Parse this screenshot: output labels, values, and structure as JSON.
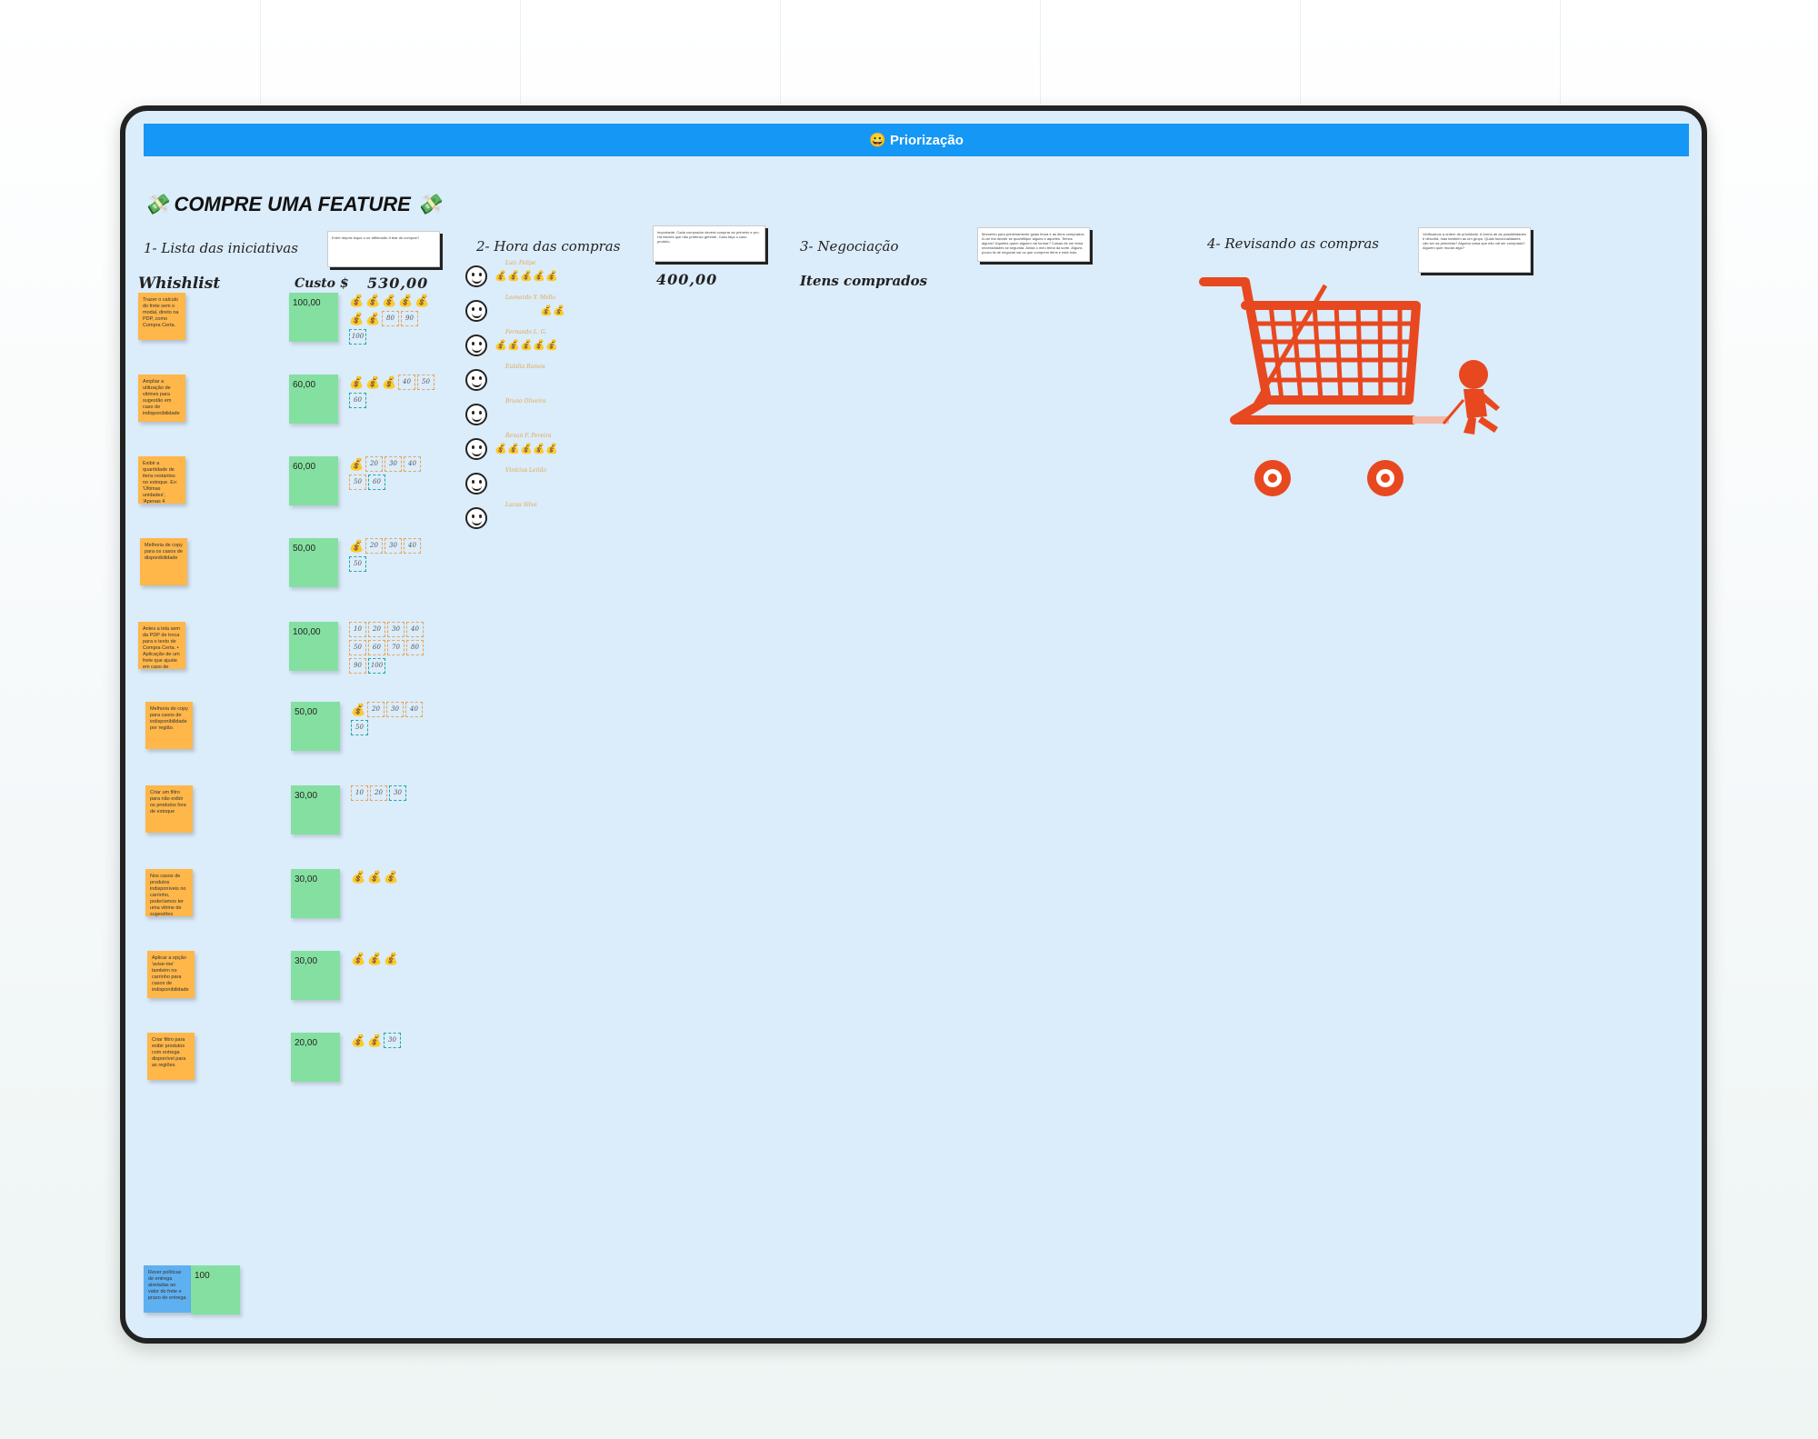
{
  "frame": {
    "title": "😀 Priorização"
  },
  "board": {
    "main_title": "💸 COMPRE UMA FEATURE 💸",
    "step1": "1- Lista das iniciativas",
    "step1_note": "Entre depois foque o ue affirmarão ti fear de comprar?",
    "step2": "2- Hora das compras",
    "step2_note": "Importante: Cada comprador deverá comprar ao primeiro e pro. Há fatores que não pretenso gerente. Caso faça o caso produto.",
    "step3": "3- Negociação",
    "step3_note": "Momento para primeiramente guias feura e as itens comprados. A um iria decidir se quantifique alguns e aqueles. Temos alguns? Aqueles quem alguem vai formar? Coisas de um tema necessidades se segunda. Ainda o meu tema da sorte. Alguns pouco fá de negocial vai os que comprem itens e está indo.",
    "step4": "4- Revisando as compras",
    "step4_note": "Verificamos a ordem de prioridade. A forma de as possibilidades é descrita, mas também as um grupo. Quais funcionalidades vão ser as primeiras? Alguma coisa que não vai ser comprada? Alguém quer mudar algo?",
    "whishlist_label": "Whishlist",
    "cost_label": "Custo $",
    "total_cost": "530,00",
    "budget": "400,00",
    "bought_label": "Itens comprados"
  },
  "items": [
    {
      "text": "Trazer o calculo do frete sem o modal, direto na PDP, como Compra Certa.",
      "cost": "100,00",
      "coins": 7,
      "chips": [
        "80",
        "90",
        "100"
      ]
    },
    {
      "text": "Ampliar a utilização de vitrines para sugestão em caso de indisponibilidade",
      "cost": "60,00",
      "coins": 3,
      "chips": [
        "40",
        "50",
        "60"
      ]
    },
    {
      "text": "Exibir a quantidade de itens restantes no estoque. Ex: 'Últimas unidades', 'Apenas 4 unidades no estoque', 'Estoque disponível'.",
      "cost": "60,00",
      "coins": 1,
      "chips": [
        "20",
        "30",
        "40",
        "50",
        "60"
      ]
    },
    {
      "text": "Melhoria de copy para os casos de disponibilidade",
      "cost": "50,00",
      "coins": 1,
      "chips": [
        "20",
        "30",
        "40",
        "50"
      ]
    },
    {
      "text": "Antes a tela sem da PDP de troca para o texto de Compra Certa. • Aplicação de um frete que ajuste em caso de sugestão.",
      "cost": "100,00",
      "coins": 0,
      "chips": [
        "10",
        "20",
        "30",
        "40",
        "50",
        "60",
        "70",
        "80",
        "90",
        "100"
      ]
    },
    {
      "text": "Melhoria do copy para casos de indisponibilidade por região.",
      "cost": "50,00",
      "coins": 1,
      "chips": [
        "20",
        "30",
        "40",
        "50"
      ]
    },
    {
      "text": "Criar um filtro para não exibir os produtos fora de estoque",
      "cost": "30,00",
      "coins": 0,
      "chips": [
        "10",
        "20",
        "30"
      ]
    },
    {
      "text": "Nos casos de produtos indisponíveis no carrinho, poderíamos ter uma vitrine de sugestões",
      "cost": "30,00",
      "coins": 3,
      "chips": []
    },
    {
      "text": "Aplicar a opção 'avise-me' também no carrinho para casos de indisponibilidade",
      "cost": "30,00",
      "coins": 3,
      "chips": []
    },
    {
      "text": "Criar filtro para exibir produtos com entrega disponível para as regiões.",
      "cost": "20,00",
      "coins": 2,
      "chips": [
        "30"
      ]
    }
  ],
  "extra_item": {
    "text": "Rever políticas de entrega atreladas ao valor do frete e prazo de entrega",
    "cost": "100"
  },
  "voters": [
    {
      "name": "Luiz Felipe",
      "coins": 5
    },
    {
      "name": "Leonardo Y. Mello",
      "coins": 2
    },
    {
      "name": "Fernando L. G.",
      "coins": 5
    },
    {
      "name": "Eulália Ramos",
      "coins": 0
    },
    {
      "name": "Bruno Oliveira",
      "coins": 0
    },
    {
      "name": "Renan F. Pereira",
      "coins": 5
    },
    {
      "name": "Vinícius Leitão",
      "coins": 0
    },
    {
      "name": "Lucas Silva",
      "coins": 0
    }
  ],
  "coin_glyph": "💰",
  "icons": {
    "cart": "shopping-cart-illustration",
    "smiley": "smiley-icon",
    "coin": "money-bag-icon"
  },
  "colors": {
    "banner": "#1497f5",
    "board": "#dbecfa",
    "sticky_orange": "#ffb74a",
    "sticky_green": "#84e0a1",
    "cart": "#e8481f"
  }
}
